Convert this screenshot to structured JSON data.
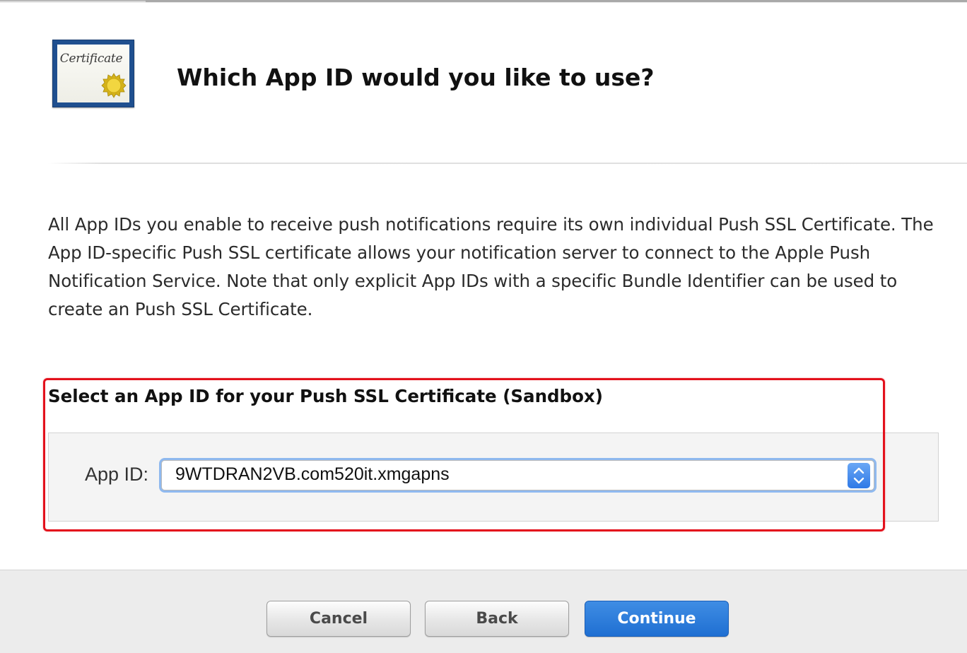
{
  "header": {
    "title": "Which App ID would you like to use?",
    "icon": "certificate-icon",
    "icon_text": "Certificate"
  },
  "description": "All App IDs you enable to receive push notifications require its own individual Push SSL Certificate. The App ID-specific Push SSL certificate allows your notification server to connect to the Apple Push Notification Service. Note that only explicit App IDs with a specific Bundle Identifier can be used to create an Push SSL Certificate.",
  "selection": {
    "section_title": "Select an App ID for your Push SSL Certificate (Sandbox)",
    "app_id_label": "App ID:",
    "app_id_value": "9WTDRAN2VB.com520it.xmgapns",
    "highlight_color": "#e3111c"
  },
  "footer": {
    "cancel_label": "Cancel",
    "back_label": "Back",
    "continue_label": "Continue"
  },
  "colors": {
    "primary_button": "#1f6fd2",
    "focus_ring": "#8fb9ef"
  }
}
